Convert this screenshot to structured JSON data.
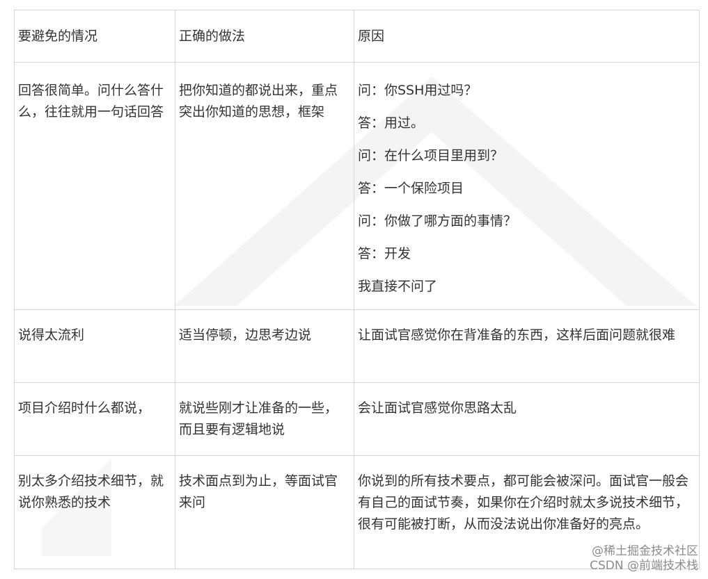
{
  "table": {
    "headers": [
      "要避免的情况",
      "正确的做法",
      "原因"
    ],
    "rows": [
      {
        "avoid": "回答很简单。问什么答什么，往往就用一句话回答",
        "correct": "把你知道的都说出来，重点突出你知道的思想，框架",
        "reason_lines": [
          "问：你SSH用过吗？",
          "答：用过。",
          "问：在什么项目里用到？",
          "答：一个保险项目",
          "问：你做了哪方面的事情？",
          "答：开发",
          "我直接不问了"
        ]
      },
      {
        "avoid": "说得太流利",
        "correct": "适当停顿，边思考边说",
        "reason": "让面试官感觉你在背准备的东西，这样后面问题就很难"
      },
      {
        "avoid": "项目介绍时什么都说，",
        "correct": "就说些刚才让准备的一些，而且要有逻辑地说",
        "reason": "会让面试官感觉你思路太乱"
      },
      {
        "avoid": "别太多介绍技术细节，就说你熟悉的技术",
        "correct": "技术面点到为止，等面试官来问",
        "reason": "你说到的所有技术要点，都可能会被深问。面试官一般会有自己的面试节奏，如果你在介绍时就太多说技术细节，很有可能被打断，从而没法说出你准备好的亮点。"
      }
    ]
  },
  "watermark": {
    "line1": "@稀土掘金技术社区",
    "line2": "CSDN @前端技术栈"
  }
}
